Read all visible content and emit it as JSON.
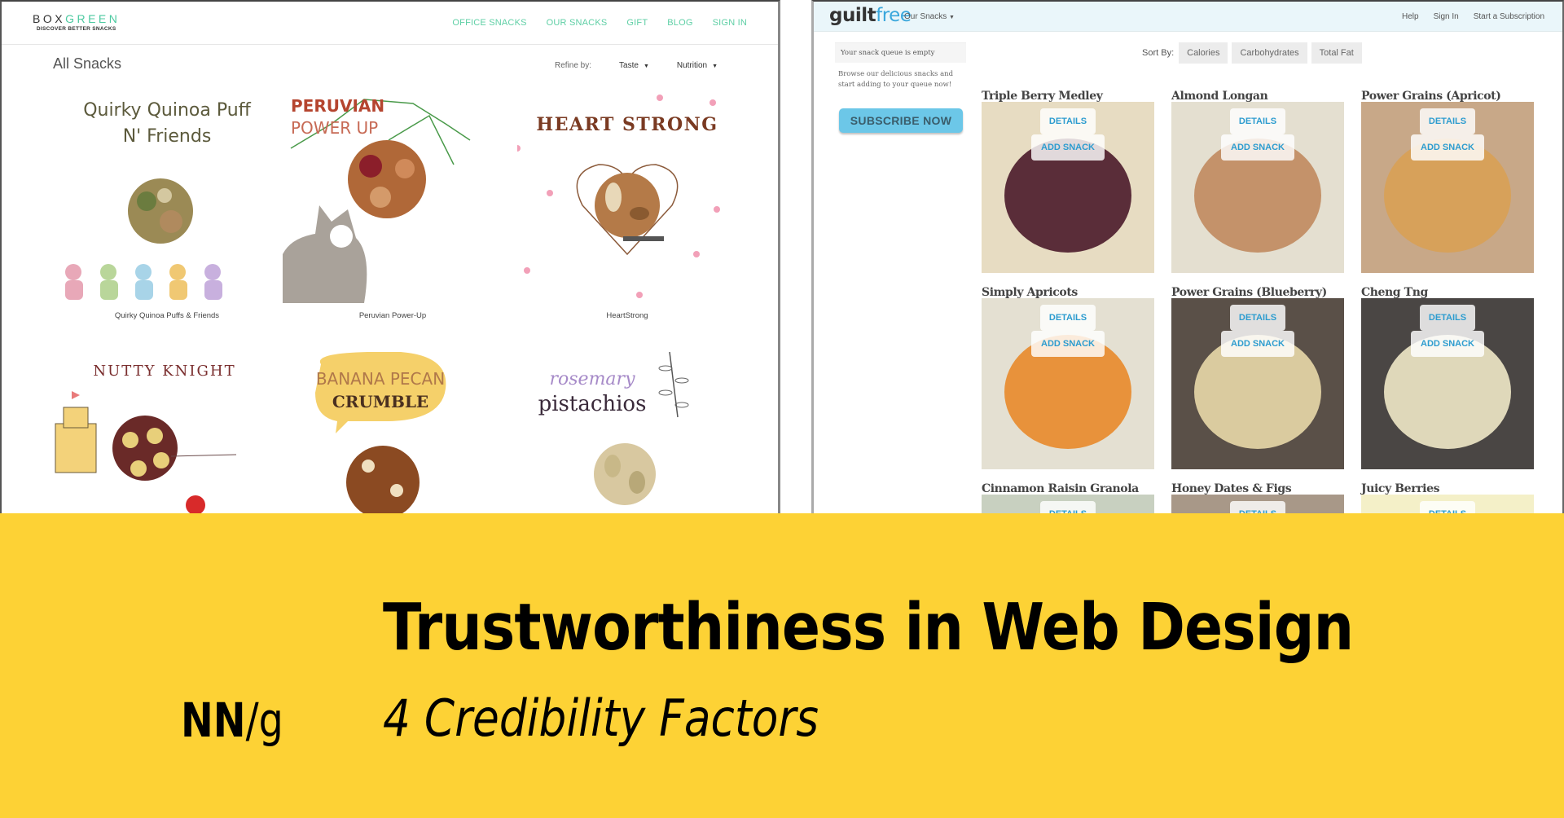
{
  "boxgreen": {
    "logo": {
      "word_dark": "BOX",
      "word_green": "GREEN",
      "tagline": "DISCOVER BETTER SNACKS"
    },
    "nav": [
      "OFFICE SNACKS",
      "OUR SNACKS",
      "GIFT",
      "BLOG",
      "SIGN IN"
    ],
    "page_title": "All Snacks",
    "refine": {
      "label": "Refine by:",
      "filters": [
        "Taste",
        "Nutrition"
      ]
    },
    "products": [
      {
        "art_title": [
          "Quirky Quinoa Puff",
          "N' Friends"
        ],
        "label": "Quirky Quinoa Puffs & Friends"
      },
      {
        "art_title": [
          "PERUVIAN",
          "POWER UP"
        ],
        "label": "Peruvian Power-Up"
      },
      {
        "art_title": [
          "HEART STRONG"
        ],
        "label": "HeartStrong"
      },
      {
        "art_title": [
          "NUTTY KNIGHT"
        ],
        "label": ""
      },
      {
        "art_title": [
          "BANANA PECAN",
          "CRUMBLE"
        ],
        "label": ""
      },
      {
        "art_title": [
          "rosemary",
          "pistachios"
        ],
        "label": ""
      }
    ],
    "colors": {
      "brand_green": "#4cc9a0",
      "nav": "#5ecfa5"
    }
  },
  "guiltfree": {
    "logo": {
      "part1": "guilt",
      "part2": "free"
    },
    "our_snacks": "Our Snacks",
    "nav": [
      "Help",
      "Sign In",
      "Start a Subscription"
    ],
    "queue_status": "Your snack queue is empty",
    "browse_text": "Browse our delicious snacks and start adding to your queue now!",
    "subscribe_label": "SUBSCRIBE NOW",
    "sort": {
      "label": "Sort By:",
      "options": [
        "Calories",
        "Carbohydrates",
        "Total Fat"
      ]
    },
    "tile_buttons": {
      "details": "DETAILS",
      "add": "ADD SNACK"
    },
    "products": [
      "Triple Berry Medley",
      "Almond Longan",
      "Power Grains (Apricot)",
      "Simply Apricots",
      "Power Grains (Blueberry)",
      "Cheng Tng",
      "Cinnamon Raisin Granola",
      "Honey Dates & Figs",
      "Juicy Berries"
    ],
    "colors": {
      "accent": "#3aa7dc",
      "subscribe": "#6cc7e8",
      "header_bg": "#eaf6fa"
    }
  },
  "banner": {
    "title": "Trustworthiness in Web Design",
    "subtitle": "4 Credibility Factors",
    "logo_nn": "NN",
    "logo_g": "/g",
    "background": "#fdd235"
  }
}
